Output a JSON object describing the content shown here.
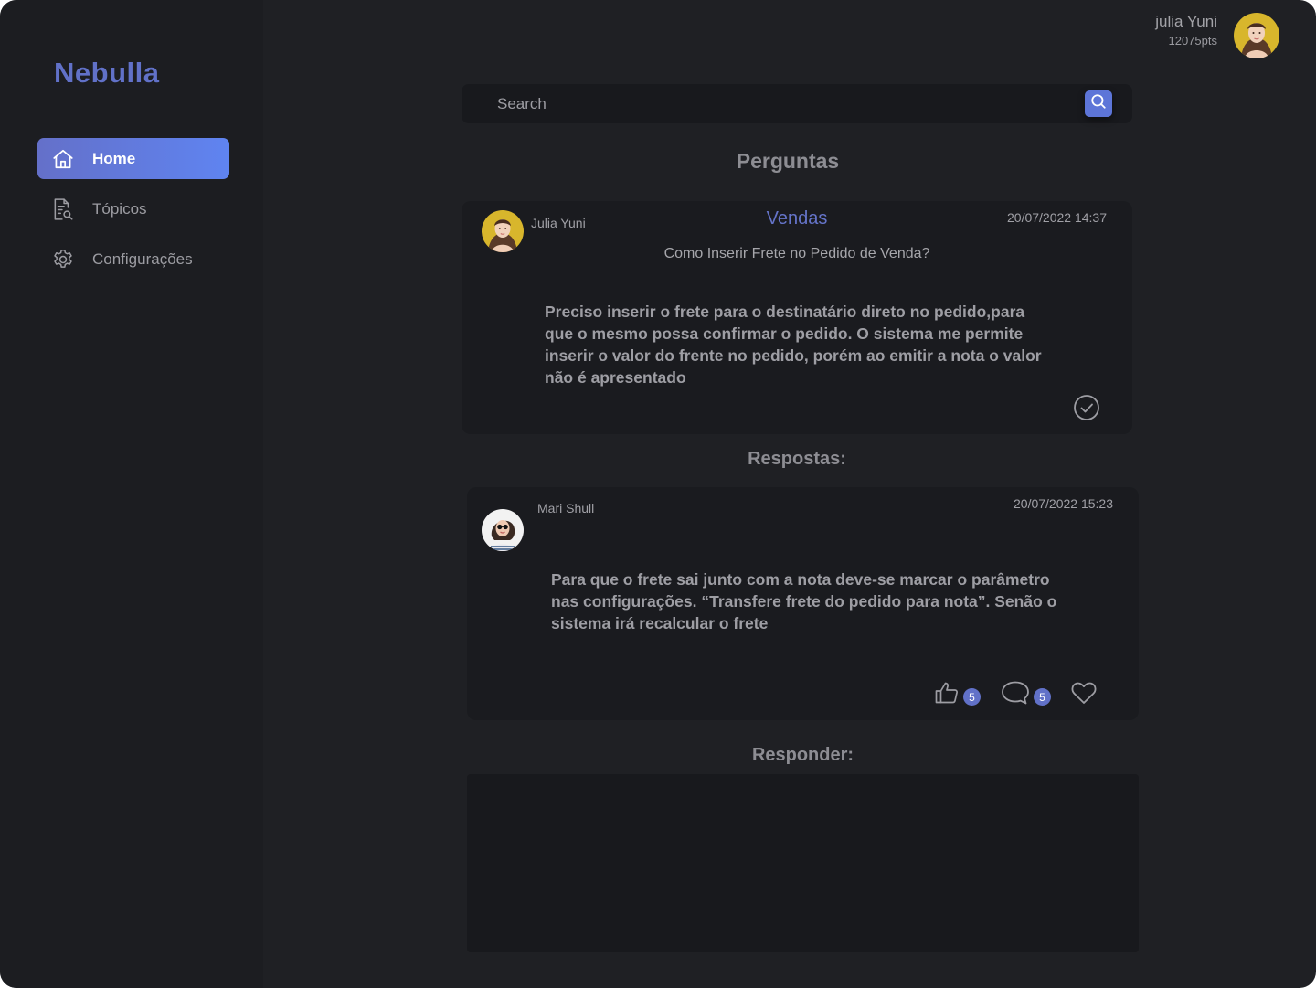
{
  "app": {
    "brand": "Nebulla",
    "accent": "#6171c8"
  },
  "sidebar": {
    "items": [
      {
        "label": "Home",
        "icon": "home-icon",
        "active": true
      },
      {
        "label": "Tópicos",
        "icon": "document-search-icon",
        "active": false
      },
      {
        "label": "Configurações",
        "icon": "gear-icon",
        "active": false
      }
    ]
  },
  "user": {
    "name": "julia Yuni",
    "points": "12075pts"
  },
  "search": {
    "placeholder": "Search",
    "value": ""
  },
  "questions_title": "Perguntas",
  "question": {
    "author": "Julia Yuni",
    "category": "Vendas",
    "date": "20/07/2022 14:37",
    "title": "Como Inserir Frete no Pedido de Venda?",
    "body": "Preciso inserir o frete para o destinatário direto no pedido,para que o mesmo possa confirmar o pedido. O sistema me permite inserir o valor do frente no pedido, porém ao emitir a nota o valor não é apresentado"
  },
  "answers_title": "Respostas:",
  "answer": {
    "author": "Mari Shull",
    "date": "20/07/2022 15:23",
    "body": "Para que o frete sai junto com a nota deve-se marcar o parâmetro nas configurações. “Transfere frete do pedido para nota”. Senão o sistema irá recalcular o frete",
    "likes": "5",
    "comments": "5"
  },
  "reply": {
    "title": "Responder:",
    "value": ""
  }
}
